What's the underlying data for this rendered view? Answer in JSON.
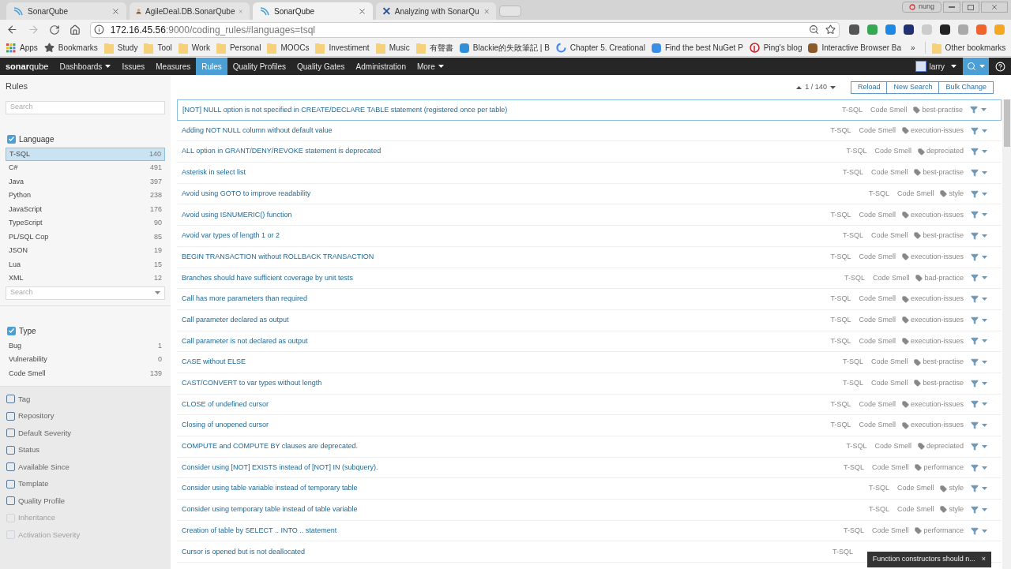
{
  "browser": {
    "tabs": [
      {
        "title": "SonarQube",
        "selected": false
      },
      {
        "title": "AgileDeal.DB.SonarQube",
        "selected": false
      },
      {
        "title": "SonarQube",
        "selected": true
      },
      {
        "title": "Analyzing with SonarQu",
        "selected": false
      }
    ],
    "user_badge": "nung",
    "address": {
      "host": "172.16.45.56",
      "rest": ":9000/coding_rules#languages=tsql"
    },
    "bookmarks": [
      {
        "label": "Apps",
        "kind": "apps"
      },
      {
        "label": "Bookmarks",
        "kind": "star"
      },
      {
        "label": "Study",
        "kind": "folder"
      },
      {
        "label": "Tool",
        "kind": "folder"
      },
      {
        "label": "Work",
        "kind": "folder"
      },
      {
        "label": "Personal",
        "kind": "folder"
      },
      {
        "label": "MOOCs",
        "kind": "folder"
      },
      {
        "label": "Investiment",
        "kind": "folder"
      },
      {
        "label": "Music",
        "kind": "folder"
      },
      {
        "label": "有聲書",
        "kind": "folder"
      },
      {
        "label": "Blackie的失敗筆記 | B",
        "kind": "site",
        "color": "#2f8fd8"
      },
      {
        "label": "Chapter 5. Creational",
        "kind": "google"
      },
      {
        "label": "Find the best NuGet P",
        "kind": "site",
        "color": "#3a8ee6"
      },
      {
        "label": "Ping's blog",
        "kind": "pinterest"
      },
      {
        "label": "Interactive Browser Ba",
        "kind": "site",
        "color": "#8a5a2a"
      }
    ],
    "more_bookmarks": "»",
    "other_bookmarks": "Other bookmarks"
  },
  "nav": {
    "logo": {
      "a": "sonar",
      "b": "qube"
    },
    "items": [
      {
        "label": "Dashboards",
        "dropdown": true,
        "selected": false
      },
      {
        "label": "Issues",
        "dropdown": false,
        "selected": false
      },
      {
        "label": "Measures",
        "dropdown": false,
        "selected": false
      },
      {
        "label": "Rules",
        "dropdown": false,
        "selected": true
      },
      {
        "label": "Quality Profiles",
        "dropdown": false,
        "selected": false
      },
      {
        "label": "Quality Gates",
        "dropdown": false,
        "selected": false
      },
      {
        "label": "Administration",
        "dropdown": false,
        "selected": false
      },
      {
        "label": "More",
        "dropdown": true,
        "selected": false
      }
    ],
    "user": "larry"
  },
  "sidebar": {
    "title": "Rules",
    "search_placeholder": "Search",
    "facets": [
      {
        "label": "Language",
        "checked": true,
        "disabled": false,
        "search_placeholder": "Search",
        "items": [
          {
            "label": "T-SQL",
            "count": "140",
            "selected": true
          },
          {
            "label": "C#",
            "count": "491",
            "selected": false
          },
          {
            "label": "Java",
            "count": "397",
            "selected": false
          },
          {
            "label": "Python",
            "count": "238",
            "selected": false
          },
          {
            "label": "JavaScript",
            "count": "176",
            "selected": false
          },
          {
            "label": "TypeScript",
            "count": "90",
            "selected": false
          },
          {
            "label": "PL/SQL Cop",
            "count": "85",
            "selected": false
          },
          {
            "label": "JSON",
            "count": "19",
            "selected": false
          },
          {
            "label": "Lua",
            "count": "15",
            "selected": false
          },
          {
            "label": "XML",
            "count": "12",
            "selected": false
          }
        ]
      },
      {
        "label": "Type",
        "checked": true,
        "disabled": false,
        "items": [
          {
            "label": "Bug",
            "count": "1",
            "selected": false
          },
          {
            "label": "Vulnerability",
            "count": "0",
            "selected": false
          },
          {
            "label": "Code Smell",
            "count": "139",
            "selected": false
          }
        ]
      },
      {
        "label": "Tag",
        "checked": false,
        "disabled": false
      },
      {
        "label": "Repository",
        "checked": false,
        "disabled": false
      },
      {
        "label": "Default Severity",
        "checked": false,
        "disabled": false
      },
      {
        "label": "Status",
        "checked": false,
        "disabled": false
      },
      {
        "label": "Available Since",
        "checked": false,
        "disabled": false
      },
      {
        "label": "Template",
        "checked": false,
        "disabled": false
      },
      {
        "label": "Quality Profile",
        "checked": false,
        "disabled": false
      },
      {
        "label": "Inheritance",
        "checked": false,
        "disabled": true
      },
      {
        "label": "Activation Severity",
        "checked": false,
        "disabled": true
      }
    ]
  },
  "toolbar": {
    "paging": "1 / 140",
    "buttons": [
      "Reload",
      "New Search",
      "Bulk Change"
    ]
  },
  "rules": [
    {
      "name": "[NOT] NULL option is not specified in CREATE/DECLARE TABLE statement (registered once per table)",
      "language": "T-SQL",
      "type": "Code Smell",
      "tag": "best-practise",
      "selected": true
    },
    {
      "name": "Adding NOT NULL column without default value",
      "language": "T-SQL",
      "type": "Code Smell",
      "tag": "execution-issues",
      "selected": false
    },
    {
      "name": "ALL option in GRANT/DENY/REVOKE statement is deprecated",
      "language": "T-SQL",
      "type": "Code Smell",
      "tag": "depreciated",
      "selected": false
    },
    {
      "name": "Asterisk in select list",
      "language": "T-SQL",
      "type": "Code Smell",
      "tag": "best-practise",
      "selected": false
    },
    {
      "name": "Avoid using GOTO to improve readability",
      "language": "T-SQL",
      "type": "Code Smell",
      "tag": "style",
      "selected": false
    },
    {
      "name": "Avoid using ISNUMERIC() function",
      "language": "T-SQL",
      "type": "Code Smell",
      "tag": "execution-issues",
      "selected": false
    },
    {
      "name": "Avoid var types of length 1 or 2",
      "language": "T-SQL",
      "type": "Code Smell",
      "tag": "best-practise",
      "selected": false
    },
    {
      "name": "BEGIN TRANSACTION without ROLLBACK TRANSACTION",
      "language": "T-SQL",
      "type": "Code Smell",
      "tag": "execution-issues",
      "selected": false
    },
    {
      "name": "Branches should have sufficient coverage by unit tests",
      "language": "T-SQL",
      "type": "Code Smell",
      "tag": "bad-practice",
      "selected": false
    },
    {
      "name": "Call has more parameters than required",
      "language": "T-SQL",
      "type": "Code Smell",
      "tag": "execution-issues",
      "selected": false
    },
    {
      "name": "Call parameter declared as output",
      "language": "T-SQL",
      "type": "Code Smell",
      "tag": "execution-issues",
      "selected": false
    },
    {
      "name": "Call parameter is not declared as output",
      "language": "T-SQL",
      "type": "Code Smell",
      "tag": "execution-issues",
      "selected": false
    },
    {
      "name": "CASE without ELSE",
      "language": "T-SQL",
      "type": "Code Smell",
      "tag": "best-practise",
      "selected": false
    },
    {
      "name": "CAST/CONVERT to var types without length",
      "language": "T-SQL",
      "type": "Code Smell",
      "tag": "best-practise",
      "selected": false
    },
    {
      "name": "CLOSE of undefined cursor",
      "language": "T-SQL",
      "type": "Code Smell",
      "tag": "execution-issues",
      "selected": false
    },
    {
      "name": "Closing of unopened cursor",
      "language": "T-SQL",
      "type": "Code Smell",
      "tag": "execution-issues",
      "selected": false
    },
    {
      "name": "COMPUTE and COMPUTE BY clauses are deprecated.",
      "language": "T-SQL",
      "type": "Code Smell",
      "tag": "depreciated",
      "selected": false
    },
    {
      "name": "Consider using [NOT] EXISTS instead of [NOT] IN (subquery).",
      "language": "T-SQL",
      "type": "Code Smell",
      "tag": "performance",
      "selected": false
    },
    {
      "name": "Consider using table variable instead of temporary table",
      "language": "T-SQL",
      "type": "Code Smell",
      "tag": "style",
      "selected": false
    },
    {
      "name": "Consider using temporary table instead of table variable",
      "language": "T-SQL",
      "type": "Code Smell",
      "tag": "style",
      "selected": false
    },
    {
      "name": "Creation of table by SELECT .. INTO .. statement",
      "language": "T-SQL",
      "type": "Code Smell",
      "tag": "performance",
      "selected": false
    },
    {
      "name": "Cursor is opened but is not deallocated",
      "language": "T-SQL",
      "selected": false
    }
  ],
  "toast": {
    "text": "Function constructors should n...",
    "close": "×"
  }
}
